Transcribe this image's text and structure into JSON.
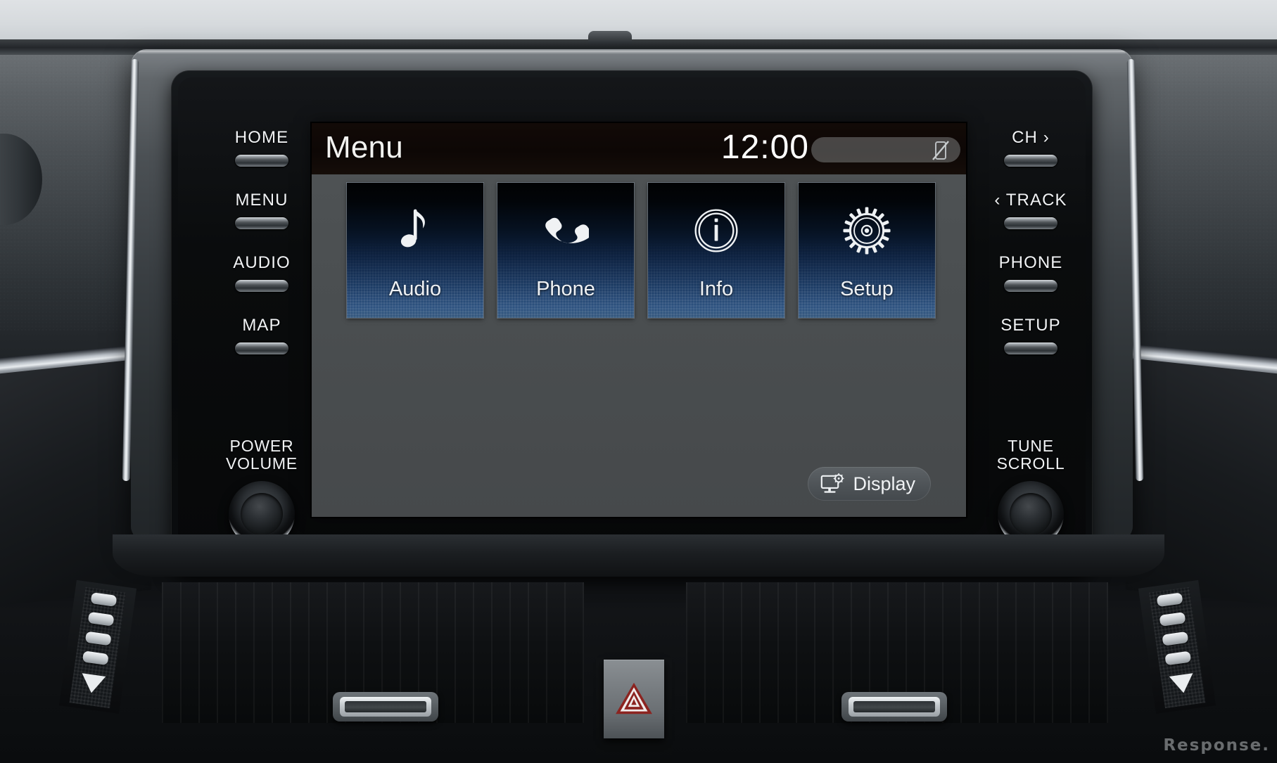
{
  "screen": {
    "title": "Menu",
    "clock": "12:00",
    "status_icon": "phone-disconnected-icon",
    "tiles": [
      {
        "label": "Audio",
        "icon": "music-note-icon"
      },
      {
        "label": "Phone",
        "icon": "phone-handset-icon"
      },
      {
        "label": "Info",
        "icon": "info-circle-icon"
      },
      {
        "label": "Setup",
        "icon": "gear-icon"
      }
    ],
    "display_button": {
      "label": "Display",
      "icon": "monitor-gear-icon"
    }
  },
  "left_buttons": [
    {
      "label": "HOME"
    },
    {
      "label": "MENU"
    },
    {
      "label": "AUDIO"
    },
    {
      "label": "MAP"
    }
  ],
  "left_knob": {
    "line1": "POWER",
    "line2": "VOLUME"
  },
  "right_buttons": [
    {
      "label": "CH ›"
    },
    {
      "label": "‹ TRACK"
    },
    {
      "label": "PHONE"
    },
    {
      "label": "SETUP"
    }
  ],
  "right_knob": {
    "line1": "TUNE",
    "line2": "SCROLL"
  },
  "console": {
    "hazard_button": "hazard-triangle-icon"
  },
  "watermark": "Response.",
  "colors": {
    "tile_top": "#010203",
    "tile_bottom": "#35597f",
    "screen_bg": "#4a4e50",
    "titlebar_bg": "#0d0705",
    "text_white": "#f2f2f0",
    "hazard_red": "#9e2b26"
  }
}
